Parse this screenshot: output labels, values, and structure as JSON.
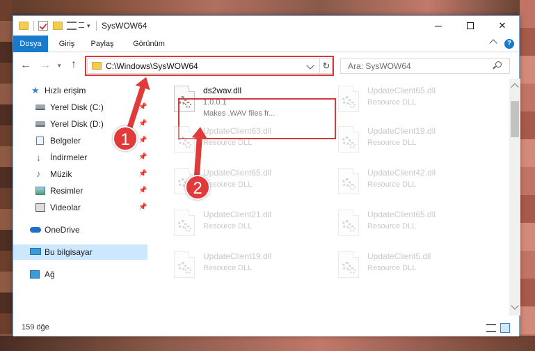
{
  "window": {
    "title": "SysWOW64",
    "minimize_label": "",
    "maximize_label": "",
    "close_label": "✕"
  },
  "ribbon": {
    "tabs": [
      {
        "label": "Dosya"
      },
      {
        "label": "Giriş"
      },
      {
        "label": "Paylaş"
      },
      {
        "label": "Görünüm"
      }
    ],
    "help_label": "?"
  },
  "address": {
    "path": "C:\\Windows\\SysWOW64",
    "search_placeholder": "Ara: SysWOW64"
  },
  "sidebar": {
    "items": [
      {
        "label": "Hızlı erişim",
        "icon": "star-icon"
      },
      {
        "label": "Yerel Disk (C:)",
        "icon": "disk-icon",
        "pinned": true
      },
      {
        "label": "Yerel Disk (D:)",
        "icon": "disk-icon",
        "pinned": true
      },
      {
        "label": "Belgeler",
        "icon": "document-icon",
        "pinned": true
      },
      {
        "label": "İndirmeler",
        "icon": "download-icon",
        "pinned": true
      },
      {
        "label": "Müzik",
        "icon": "music-icon",
        "pinned": true
      },
      {
        "label": "Resimler",
        "icon": "pictures-icon",
        "pinned": true
      },
      {
        "label": "Videolar",
        "icon": "videos-icon",
        "pinned": true
      },
      {
        "label": "OneDrive",
        "icon": "cloud-icon"
      },
      {
        "label": "Bu bilgisayar",
        "icon": "computer-icon",
        "selected": true
      },
      {
        "label": "Ağ",
        "icon": "network-icon"
      }
    ]
  },
  "files": [
    {
      "name": "ds2wav.dll",
      "line2": "1.0.0.1",
      "line3": "Makes .WAV files fr...",
      "highlighted": true
    },
    {
      "name": "UpdateClient65.dll",
      "line2": "Resource DLL"
    },
    {
      "name": "UpdateClient63.dll",
      "line2": "Resource DLL"
    },
    {
      "name": "UpdateClient19.dll",
      "line2": "Resource DLL"
    },
    {
      "name": "UpdateClient65.dll",
      "line2": "Resource DLL"
    },
    {
      "name": "UpdateClient42.dll",
      "line2": "Resource DLL"
    },
    {
      "name": "UpdateClient21.dll",
      "line2": "Resource DLL"
    },
    {
      "name": "UpdateClient65.dll",
      "line2": "Resource DLL"
    },
    {
      "name": "UpdateClient19.dll",
      "line2": "Resource DLL"
    },
    {
      "name": "UpdateClient5.dll",
      "line2": "Resource DLL"
    }
  ],
  "status": {
    "item_count": "159 öğe"
  },
  "annotations": {
    "step1": "1",
    "step2": "2",
    "color": "#e03a3a"
  },
  "colors": {
    "accent": "#1979ca",
    "selection": "#cce8ff",
    "highlight_border": "#d33b3b"
  }
}
